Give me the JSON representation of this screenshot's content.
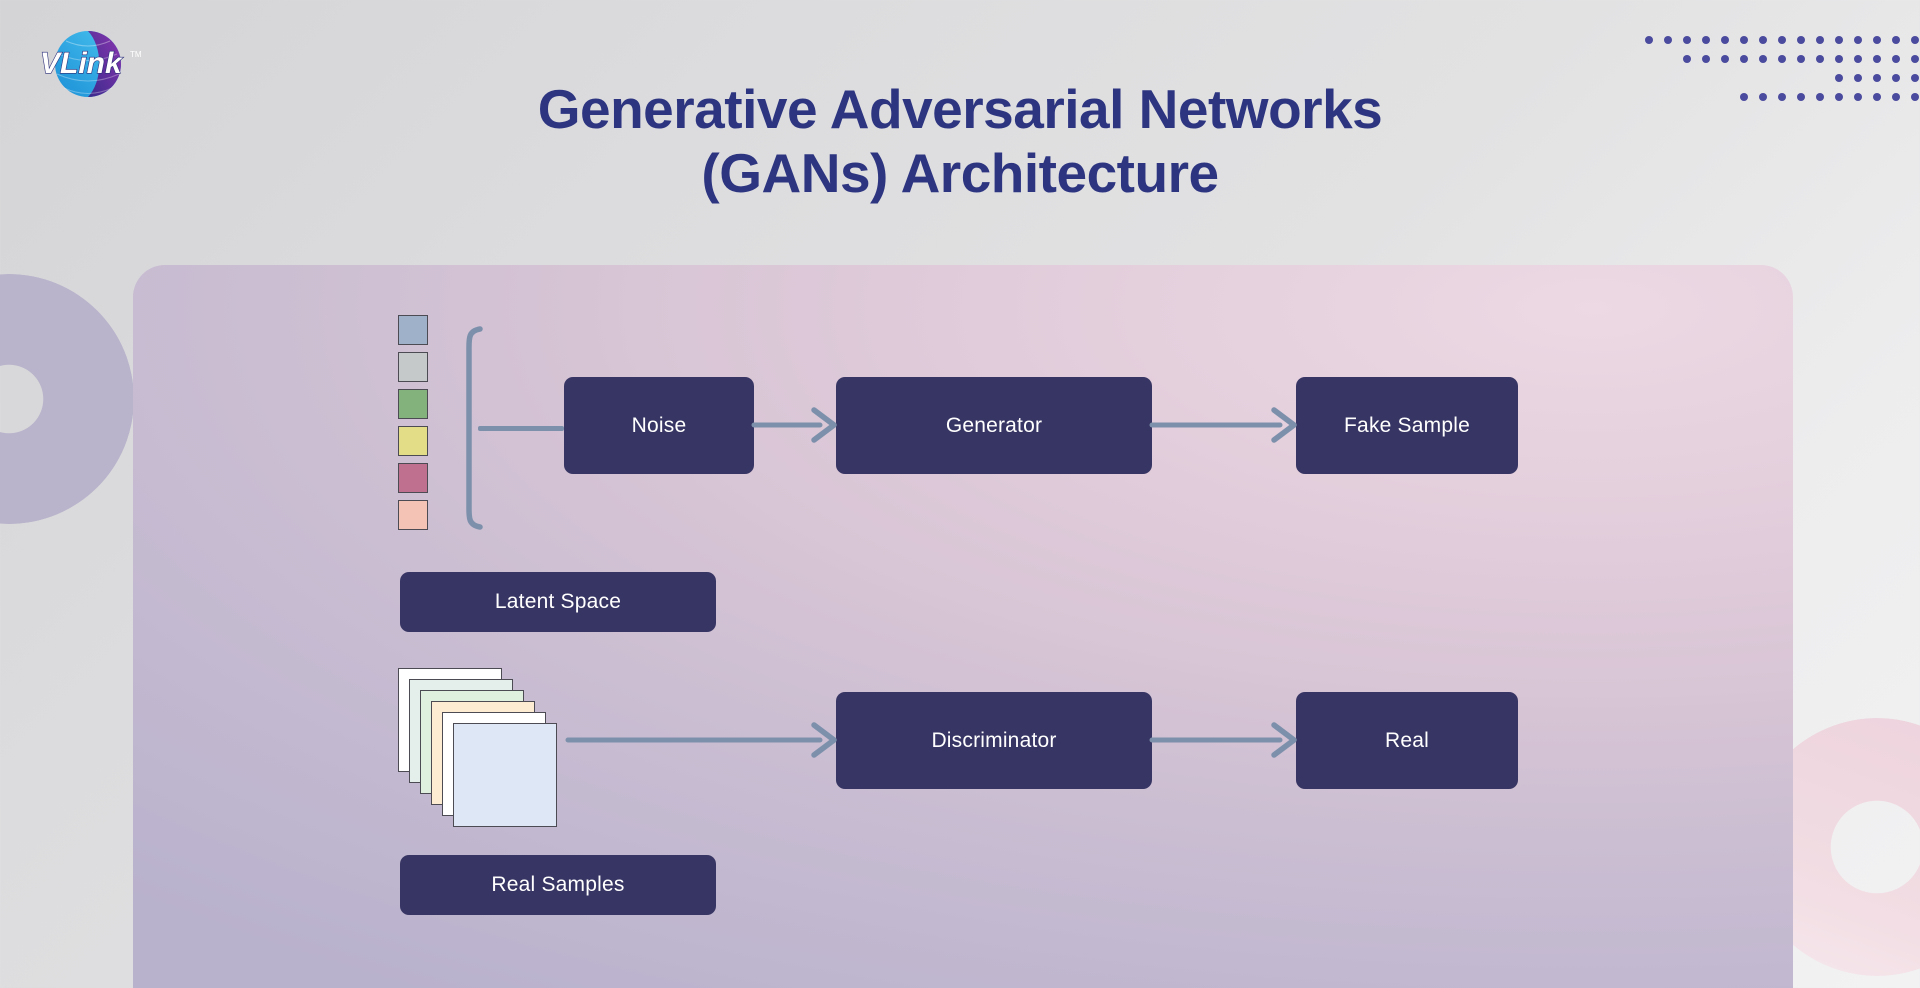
{
  "page": {
    "background_from": "#d4d4d6",
    "background_to": "#f2f2f3"
  },
  "logo": {
    "name": "vlink-logo",
    "wordmark": "VLink",
    "trademark": "TM",
    "globe_color_left": "#2ba8e0",
    "globe_color_right": "#6b2f9e"
  },
  "title": {
    "line1": "Generative Adversarial Networks",
    "line2": "(GANs) Architecture",
    "color": "#2d3580"
  },
  "dot_grid": {
    "color": "#4a4a9e",
    "rows": [
      {
        "lead": 0,
        "count": 16
      },
      {
        "lead": 2,
        "count": 14
      },
      {
        "lead": 10,
        "count": 6
      },
      {
        "lead": 5,
        "count": 11
      }
    ]
  },
  "panel": {
    "accent_top_right": "#ecd9e3",
    "accent_bottom_left": "#b9b2cd"
  },
  "decorations": {
    "ring_left_color": "#b9b3cb",
    "ring_right_color": "#edd2dc"
  },
  "diagram": {
    "node_fill": "#373563",
    "node_text_color": "#ffffff",
    "arrow_color": "#7d90ab",
    "latent_squares": [
      {
        "label": "latent-dim-1",
        "color": "#9fb0c9"
      },
      {
        "label": "latent-dim-2",
        "color": "#c6c9c9"
      },
      {
        "label": "latent-dim-3",
        "color": "#84b27c"
      },
      {
        "label": "latent-dim-4",
        "color": "#e3dd88"
      },
      {
        "label": "latent-dim-5",
        "color": "#c0708f"
      },
      {
        "label": "latent-dim-6",
        "color": "#f4c3b6"
      }
    ],
    "real_sample_cards": [
      {
        "label": "sample-1",
        "color": "#ffffff"
      },
      {
        "label": "sample-2",
        "color": "#e4eeea"
      },
      {
        "label": "sample-3",
        "color": "#dff0df"
      },
      {
        "label": "sample-4",
        "color": "#fdecd2"
      },
      {
        "label": "sample-5",
        "color": "#ffffff"
      },
      {
        "label": "sample-6",
        "color": "#dde7f5"
      }
    ],
    "nodes": {
      "noise": "Noise",
      "generator": "Generator",
      "fake_sample": "Fake Sample",
      "latent_space": "Latent Space",
      "discriminator": "Discriminator",
      "real": "Real",
      "real_samples": "Real Samples"
    },
    "edges": [
      {
        "from": "latent_space",
        "to": "noise"
      },
      {
        "from": "noise",
        "to": "generator"
      },
      {
        "from": "generator",
        "to": "fake_sample"
      },
      {
        "from": "real_samples",
        "to": "discriminator"
      },
      {
        "from": "discriminator",
        "to": "real"
      }
    ]
  }
}
